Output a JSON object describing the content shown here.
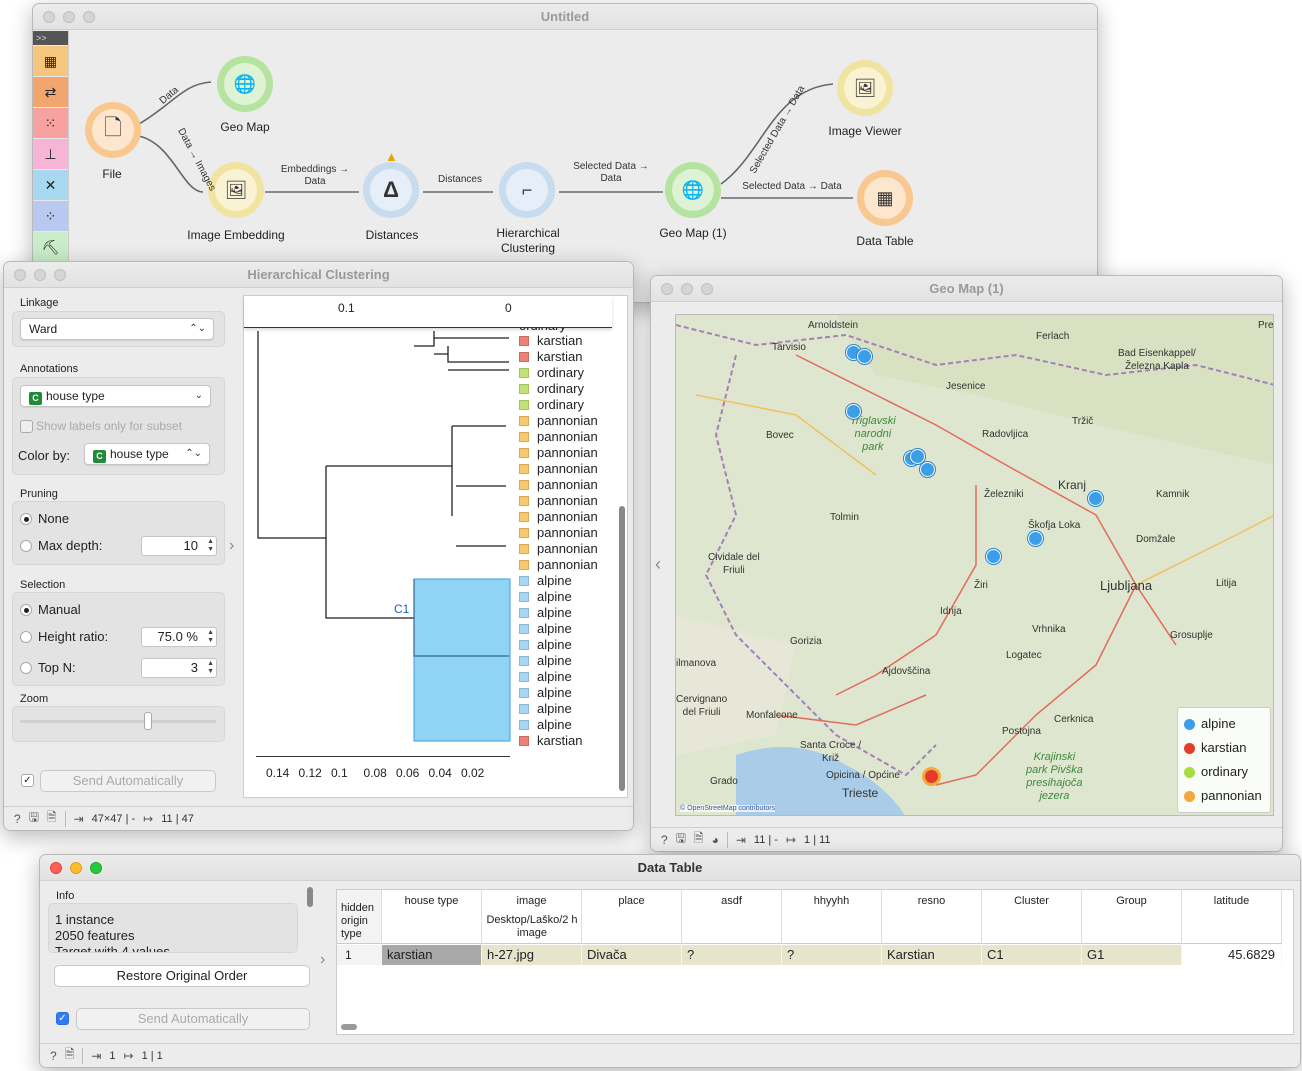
{
  "canvas": {
    "title": "Untitled",
    "nodes": {
      "file": "File",
      "geomap": "Geo Map",
      "embed": "Image Embedding",
      "dist": "Distances",
      "hclust": "Hierarchical\nClustering",
      "geomap1": "Geo Map (1)",
      "viewer": "Image Viewer",
      "table": "Data Table"
    },
    "edges": {
      "e1": "Data",
      "e2": "Data → Images",
      "e3": "Embeddings →\nData",
      "e4": "Distances",
      "e5": "Selected Data →\nData",
      "e6": "Selected Data → Data",
      "e7": "Selected Data → Data"
    }
  },
  "hc": {
    "title": "Hierarchical Clustering",
    "linkage_label": "Linkage",
    "linkage_value": "Ward",
    "annotations_label": "Annotations",
    "annotation_value": "house type",
    "badge": "C",
    "show_labels": "Show labels only for subset",
    "colorby_label": "Color by:",
    "colorby_value": "house type",
    "pruning_label": "Pruning",
    "none": "None",
    "maxdepth": "Max depth:",
    "maxdepth_val": "10",
    "selection_label": "Selection",
    "manual": "Manual",
    "height_ratio": "Height ratio:",
    "height_ratio_val": "75.0 %",
    "topn": "Top N:",
    "topn_val": "3",
    "zoom_label": "Zoom",
    "send_auto": "Send Automatically",
    "top_axis": [
      "0.1",
      "0"
    ],
    "bottom_axis": [
      "0.14",
      "0.12",
      "0.1",
      "0.08",
      "0.06",
      "0.04",
      "0.02"
    ],
    "cluster_label": "C1",
    "status_in": "47×47 | -",
    "status_out": "11 | 47",
    "leaves": [
      {
        "t": "karstian",
        "c": "#ee8077"
      },
      {
        "t": "karstian",
        "c": "#ee8077"
      },
      {
        "t": "ordinary",
        "c": "#c1e376"
      },
      {
        "t": "ordinary",
        "c": "#c1e376"
      },
      {
        "t": "ordinary",
        "c": "#c1e376"
      },
      {
        "t": "pannonian",
        "c": "#f9c86c"
      },
      {
        "t": "pannonian",
        "c": "#f9c86c"
      },
      {
        "t": "pannonian",
        "c": "#f9c86c"
      },
      {
        "t": "pannonian",
        "c": "#f9c86c"
      },
      {
        "t": "pannonian",
        "c": "#f9c86c"
      },
      {
        "t": "pannonian",
        "c": "#f9c86c"
      },
      {
        "t": "pannonian",
        "c": "#f9c86c"
      },
      {
        "t": "pannonian",
        "c": "#f9c86c"
      },
      {
        "t": "pannonian",
        "c": "#f9c86c"
      },
      {
        "t": "pannonian",
        "c": "#f9c86c"
      },
      {
        "t": "alpine",
        "c": "#a4d8f5"
      },
      {
        "t": "alpine",
        "c": "#a4d8f5"
      },
      {
        "t": "alpine",
        "c": "#a4d8f5"
      },
      {
        "t": "alpine",
        "c": "#a4d8f5"
      },
      {
        "t": "alpine",
        "c": "#a4d8f5"
      },
      {
        "t": "alpine",
        "c": "#a4d8f5"
      },
      {
        "t": "alpine",
        "c": "#a4d8f5"
      },
      {
        "t": "alpine",
        "c": "#a4d8f5"
      },
      {
        "t": "alpine",
        "c": "#a4d8f5"
      },
      {
        "t": "alpine",
        "c": "#a4d8f5"
      },
      {
        "t": "karstian",
        "c": "#ee8077"
      }
    ]
  },
  "geo": {
    "title": "Geo Map (1)",
    "towns": [
      "Arnoldstein",
      "Tarvisio",
      "Ferlach",
      "Bad Eisenkappel/\nŽelezna Kapla",
      "Jesenice",
      "Bovec",
      "Radovljica",
      "Tržič",
      "Triglavski\nnarodni\npark",
      "Kranj",
      "Kamnik",
      "Železniki",
      "Tolmin",
      "Škofja Loka",
      "Domžale",
      "Cividale del\nFriuli",
      "Žiri",
      "Ljubljana",
      "Litija",
      "Idrija",
      "Vrhnika",
      "Grosuplje",
      "Gorizia",
      "Logatec",
      "ilmanova",
      "Ajdovščina",
      "Cervignano\ndel Friuli",
      "Monfalcone",
      "Santa Croce /\nKriž",
      "Postojna",
      "Cerknica",
      "Opicina / Općine",
      "Grado",
      "Trieste",
      "Krajinski\npark Pivška\npresihajoča\njezera",
      "Pre"
    ],
    "attribution": "© OpenStreetMap contributors",
    "legend": [
      {
        "t": "alpine",
        "c": "#3b9ee8"
      },
      {
        "t": "karstian",
        "c": "#e53b2c"
      },
      {
        "t": "ordinary",
        "c": "#a6dc3c"
      },
      {
        "t": "pannonian",
        "c": "#f3a83b"
      }
    ],
    "status_in": "11 | -",
    "status_out": "1 | 11"
  },
  "dt": {
    "title": "Data Table",
    "info_label": "Info",
    "info_lines": [
      "1 instance",
      "2050  features",
      "Target with 4 values"
    ],
    "restore": "Restore Original Order",
    "send_auto": "Send Automatically",
    "hidden_header": "hidden\norigin\ntype",
    "columns": [
      "house type",
      "image",
      "place",
      "asdf",
      "hhyyhh",
      "resno",
      "Cluster",
      "Group",
      "latitude"
    ],
    "image_sub": "Desktop/Laško/2 h\nimage",
    "row_index": "1",
    "row": [
      "karstian",
      "h-27.jpg",
      "Divača",
      "?",
      "?",
      "Karstian",
      "C1",
      "G1",
      "45.6829"
    ],
    "status_in": "1",
    "status_out": "1 | 1"
  }
}
